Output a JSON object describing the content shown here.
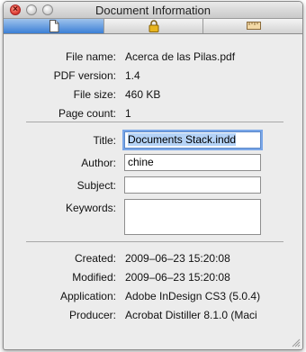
{
  "window": {
    "title": "Document Information"
  },
  "tabs": [
    {
      "icon": "page-icon",
      "selected": true
    },
    {
      "icon": "lock-icon",
      "selected": false
    },
    {
      "icon": "ruler-icon",
      "selected": false
    }
  ],
  "file_info": {
    "file_name_label": "File name:",
    "file_name": "Acerca de las Pilas.pdf",
    "pdf_version_label": "PDF version:",
    "pdf_version": "1.4",
    "file_size_label": "File size:",
    "file_size": "460 KB",
    "page_count_label": "Page count:",
    "page_count": "1"
  },
  "metadata": {
    "title_label": "Title:",
    "title": "Documents Stack.indd",
    "author_label": "Author:",
    "author": "chine",
    "subject_label": "Subject:",
    "subject": "",
    "keywords_label": "Keywords:",
    "keywords": ""
  },
  "dates": {
    "created_label": "Created:",
    "created": "2009–06–23 15:20:08",
    "modified_label": "Modified:",
    "modified": "2009–06–23 15:20:08",
    "application_label": "Application:",
    "application": "Adobe InDesign CS3 (5.0.4)",
    "producer_label": "Producer:",
    "producer": "Acrobat Distiller 8.1.0 (Maci"
  },
  "colors": {
    "selected_tab": "#3b7fd6",
    "focus_ring": "#7aa7e8",
    "close_button": "#e0443a"
  }
}
